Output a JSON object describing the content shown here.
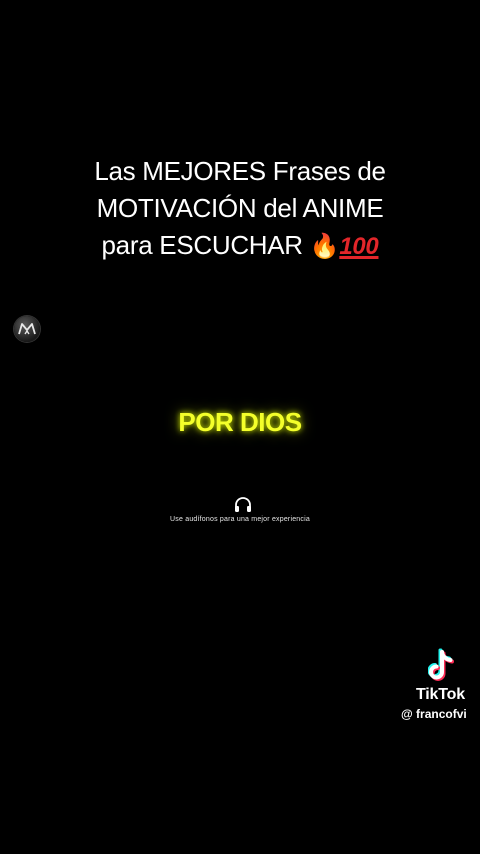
{
  "title": {
    "line1": "Las MEJORES Frases de",
    "line2": "MOTIVACIÓN del ANIME",
    "line3": "para ESCUCHAR",
    "emoji_fire": "🔥",
    "emoji_hundred": "100"
  },
  "avatar": {
    "icon": "majin-logo-icon"
  },
  "highlight_text": "POR DIOS",
  "hint": {
    "icon": "headphones-icon",
    "text": "Use audífonos para una mejor experiencia"
  },
  "watermark": {
    "brand": "TikTok",
    "handle": "@ francofvi"
  },
  "colors": {
    "background": "#000000",
    "highlight": "#f4ff2a",
    "tiktok_cyan": "#25f4ee",
    "tiktok_red": "#fe2c55"
  }
}
